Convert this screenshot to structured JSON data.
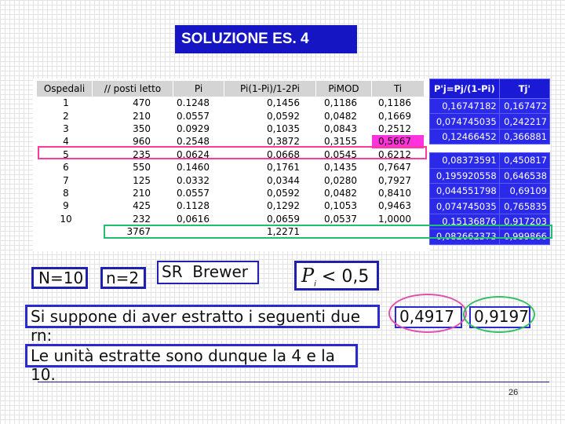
{
  "title": "SOLUZIONE ES. 4",
  "main_table": {
    "headers": [
      "Ospedali",
      "// posti letto",
      "Pi",
      "Pi(1-Pi)/1-2Pi",
      "PiMOD",
      "Ti"
    ],
    "rows": [
      [
        "1",
        "470",
        "0.1248",
        "0,1456",
        "0,1186",
        "0,1186"
      ],
      [
        "2",
        "210",
        "0.0557",
        "0,0592",
        "0,0482",
        "0,1669"
      ],
      [
        "3",
        "350",
        "0.0929",
        "0,1035",
        "0,0843",
        "0,2512"
      ],
      [
        "4",
        "960",
        "0.2548",
        "0,3872",
        "0,3155",
        "0,5667"
      ],
      [
        "5",
        "235",
        "0.0624",
        "0,0668",
        "0,0545",
        "0,6212"
      ],
      [
        "6",
        "550",
        "0.1460",
        "0,1761",
        "0,1435",
        "0,7647"
      ],
      [
        "7",
        "125",
        "0.0332",
        "0,0344",
        "0,0280",
        "0,7927"
      ],
      [
        "8",
        "210",
        "0.0557",
        "0,0592",
        "0,0482",
        "0,8410"
      ],
      [
        "9",
        "425",
        "0.1128",
        "0,1292",
        "0,1053",
        "0,9463"
      ],
      [
        "10",
        "232",
        "0,0616",
        "0,0659",
        "0,0537",
        "1,0000"
      ]
    ],
    "totals": [
      "",
      "3767",
      "",
      "1,2271",
      "",
      ""
    ]
  },
  "blue_table": {
    "headers": [
      "P'j=Pj/(1-Pi)",
      "Tj'"
    ],
    "rows": [
      [
        "0,16747182",
        "0,167472"
      ],
      [
        "0,074745035",
        "0,242217"
      ],
      [
        "0,12466452",
        "0,366881"
      ],
      [
        "",
        ""
      ],
      [
        "0,08373591",
        "0,450817"
      ],
      [
        "0,195920558",
        "0,646538"
      ],
      [
        "0,044551798",
        "0,69109"
      ],
      [
        "0,074745035",
        "0,765835"
      ],
      [
        "0,15136876",
        "0,917203"
      ],
      [
        "0,082662373",
        "0,999866"
      ]
    ]
  },
  "params": {
    "N": "N=10",
    "n": "n=2",
    "method": "SR  Brewer",
    "condition_symbol": "P",
    "condition_subscript": "i",
    "condition_rest": " < 0,5"
  },
  "sentence1": "Si suppone di aver estratto i seguenti due rn:",
  "rn1": "0,4917",
  "rn2": "0,9197",
  "sentence2": "Le unità estratte sono dunque la 4 e la 10.",
  "page_number": "26",
  "colors": {
    "title_bg": "#1515c4",
    "highlight_pink": "#ff33dd",
    "rect_pink": "#ff3a9a",
    "rect_green": "#20c070",
    "blue_cells": "#2a2ae8"
  }
}
